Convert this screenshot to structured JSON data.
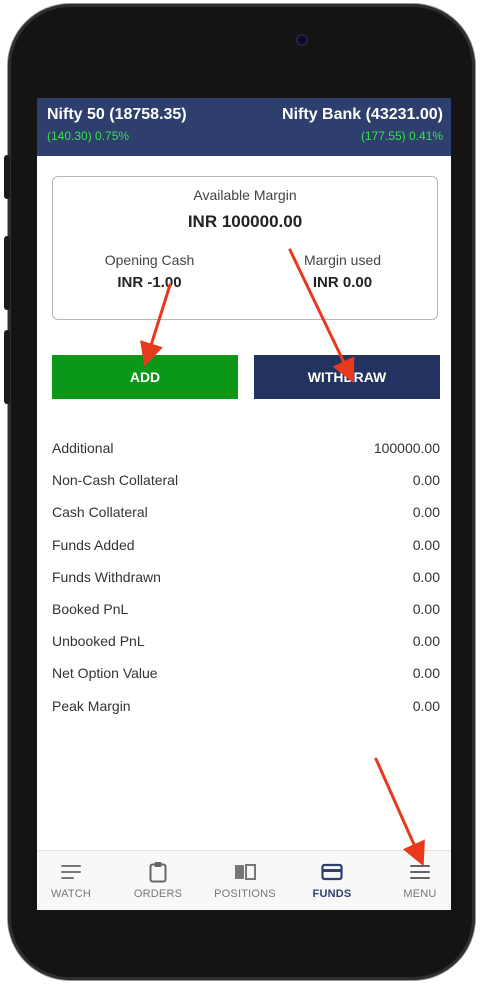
{
  "header": {
    "left": {
      "name": "Nifty 50 (18758.35)",
      "change": "(140.30) 0.75%"
    },
    "right": {
      "name": "Nifty Bank (43231.00)",
      "change": "(177.55) 0.41%"
    }
  },
  "margin_card": {
    "available_label": "Available Margin",
    "available_value": "INR 100000.00",
    "opening_cash_label": "Opening Cash",
    "opening_cash_value": "INR -1.00",
    "margin_used_label": "Margin used",
    "margin_used_value": "INR 0.00"
  },
  "buttons": {
    "add": "ADD",
    "withdraw": "WITHDRAW"
  },
  "details": [
    {
      "label": "Additional",
      "value": "100000.00"
    },
    {
      "label": "Non-Cash Collateral",
      "value": "0.00"
    },
    {
      "label": "Cash Collateral",
      "value": "0.00"
    },
    {
      "label": "Funds Added",
      "value": "0.00"
    },
    {
      "label": "Funds Withdrawn",
      "value": "0.00"
    },
    {
      "label": "Booked PnL",
      "value": "0.00"
    },
    {
      "label": "Unbooked PnL",
      "value": "0.00"
    },
    {
      "label": "Net Option Value",
      "value": "0.00"
    },
    {
      "label": "Peak Margin",
      "value": "0.00"
    }
  ],
  "nav": [
    {
      "label": "WATCH",
      "icon": "watchlist-icon"
    },
    {
      "label": "ORDERS",
      "icon": "clipboard-icon"
    },
    {
      "label": "POSITIONS",
      "icon": "book-icon"
    },
    {
      "label": "FUNDS",
      "icon": "card-icon",
      "active": true
    },
    {
      "label": "MENU",
      "icon": "hamburger-icon"
    }
  ],
  "colors": {
    "header_bg": "#2e3f6e",
    "change_green": "#36e04b",
    "add_green": "#0b9717",
    "withdraw_navy": "#22335f",
    "arrow_red": "#e8391c"
  }
}
